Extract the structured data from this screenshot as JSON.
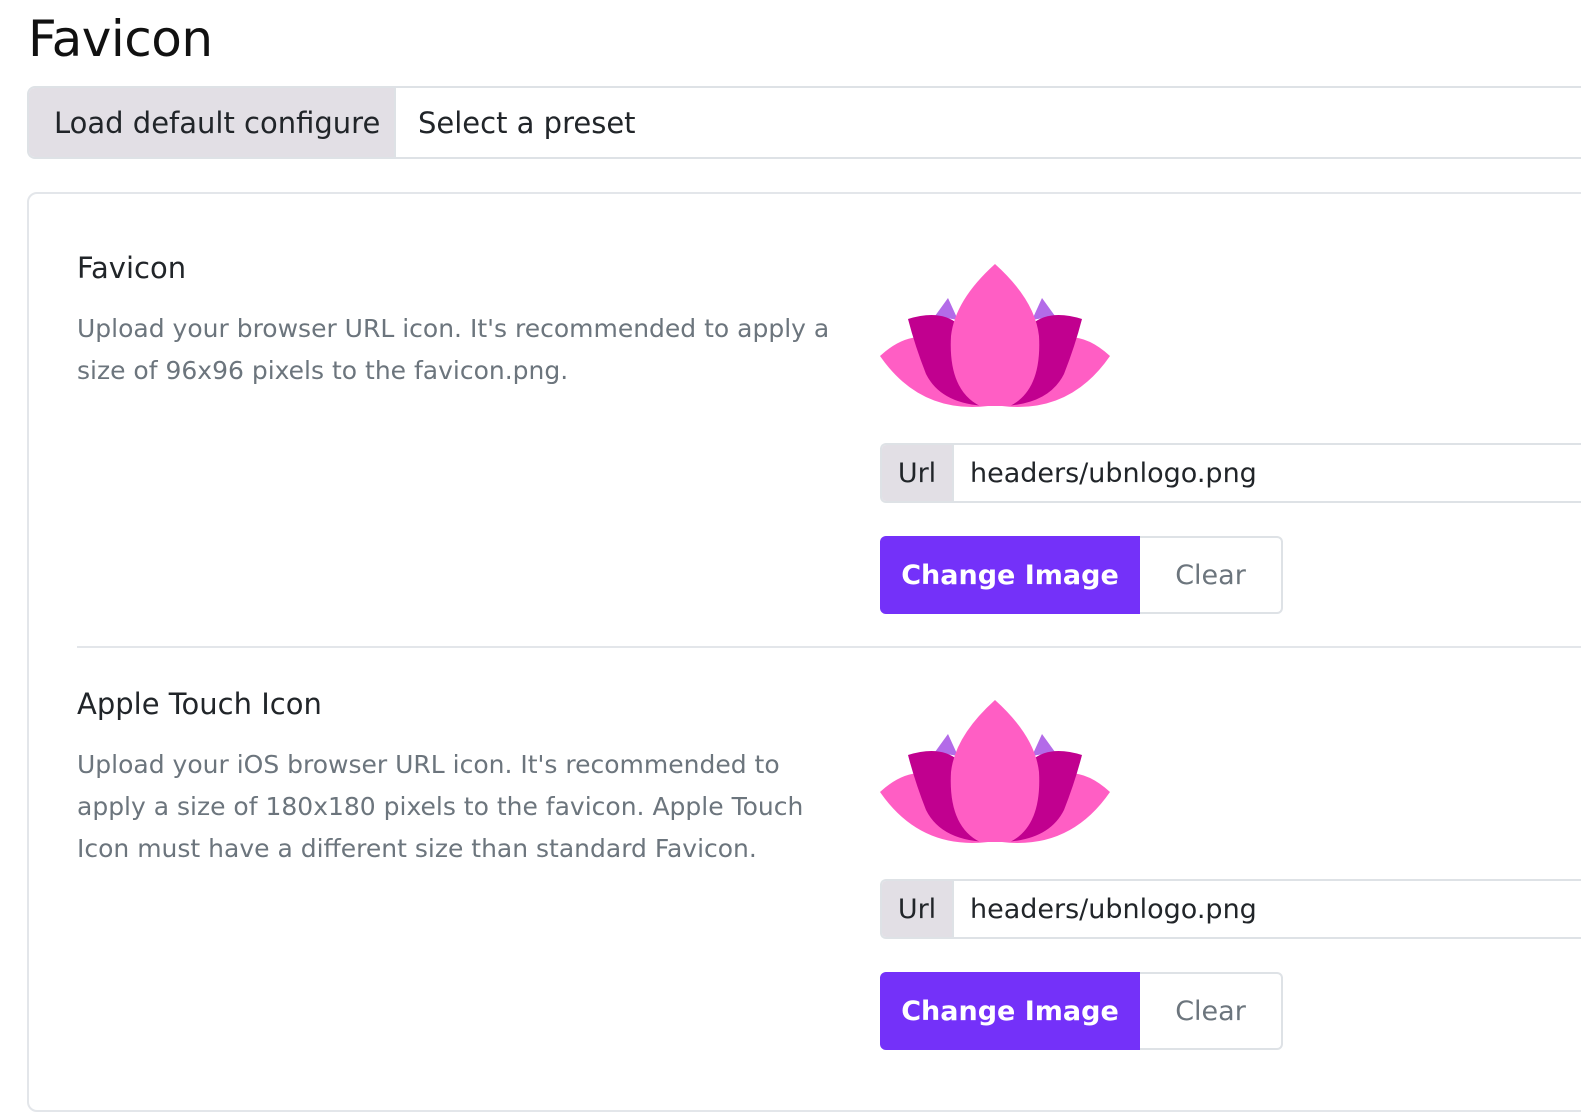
{
  "page": {
    "title": "Favicon"
  },
  "preset": {
    "load_label": "Load default configure",
    "select_label": "Select a preset"
  },
  "sections": [
    {
      "title": "Favicon",
      "description": "Upload your browser URL icon. It's recommended to apply a size of 96x96 pixels to the favicon.png.",
      "url_label": "Url",
      "url_value": "headers/ubnlogo.png",
      "change_label": "Change Image",
      "clear_label": "Clear"
    },
    {
      "title": "Apple Touch Icon",
      "description": "Upload your iOS browser URL icon. It's recommended to apply a size of 180x180 pixels to the favicon. Apple Touch Icon must have a different size than standard Favicon.",
      "url_label": "Url",
      "url_value": "headers/ubnlogo.png",
      "change_label": "Change Image",
      "clear_label": "Clear"
    }
  ],
  "colors": {
    "primary": "#7431f9",
    "addon_bg": "#e2dfe5",
    "lotus_light": "#ff5ec4",
    "lotus_dark": "#c1008f",
    "lotus_purple": "#b36be8"
  }
}
